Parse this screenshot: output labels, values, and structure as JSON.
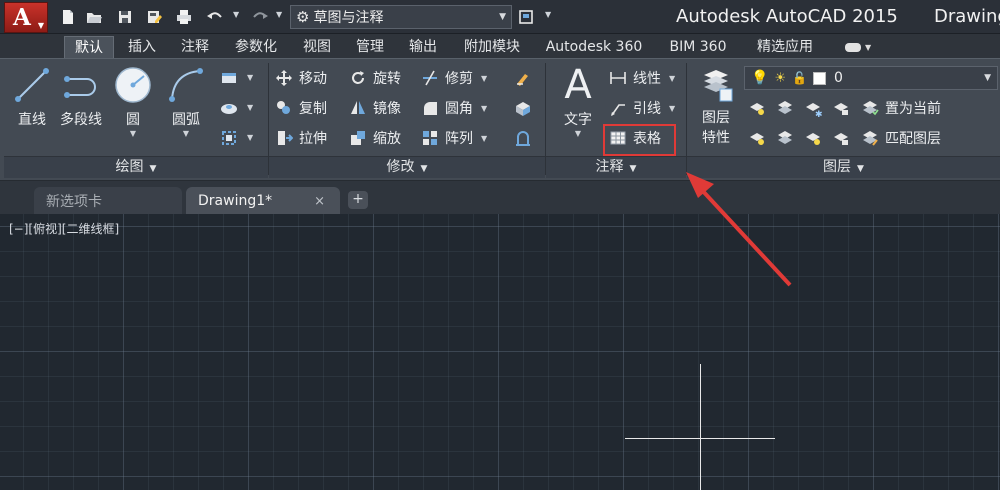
{
  "titlebar": {
    "app_title": "Autodesk AutoCAD 2015",
    "doc_title": "Drawing",
    "logo_letter": "A",
    "workspace": "草图与注释"
  },
  "quick_access": [
    "new-icon",
    "open-icon",
    "save-icon",
    "save-as-icon",
    "print-icon",
    "undo-icon",
    "redo-icon",
    "workspace-gear-icon"
  ],
  "ribbon_tabs": [
    "默认",
    "插入",
    "注释",
    "参数化",
    "视图",
    "管理",
    "输出",
    "附加模块",
    "Autodesk 360",
    "BIM 360",
    "精选应用"
  ],
  "active_tab": "默认",
  "panels": {
    "draw": {
      "title": "绘图",
      "line": "直线",
      "polyline": "多段线",
      "circle": "圆",
      "arc": "圆弧"
    },
    "modify": {
      "title": "修改",
      "move": "移动",
      "rotate": "旋转",
      "trim": "修剪",
      "copy": "复制",
      "mirror": "镜像",
      "fillet": "圆角",
      "stretch": "拉伸",
      "scale": "缩放",
      "array": "阵列"
    },
    "annotation": {
      "title": "注释",
      "text": "文字",
      "linear": "线性",
      "leader": "引线",
      "table": "表格"
    },
    "layers": {
      "title": "图层",
      "layer_properties": "图层\n特性",
      "layer_properties_line1": "图层",
      "layer_properties_line2": "特性",
      "current_layer": "0",
      "set_current": "置为当前",
      "match_layer": "匹配图层"
    }
  },
  "file_tabs": {
    "start": "新选项卡",
    "drawing": "Drawing1*",
    "close_glyph": "×",
    "new_glyph": "+"
  },
  "canvas": {
    "viewport_label": "[−][俯视][二维线框]"
  },
  "colors": {
    "accent_red": "#e03a37",
    "canvas_bg": "#212830",
    "ribbon_bg": "#434a53"
  }
}
